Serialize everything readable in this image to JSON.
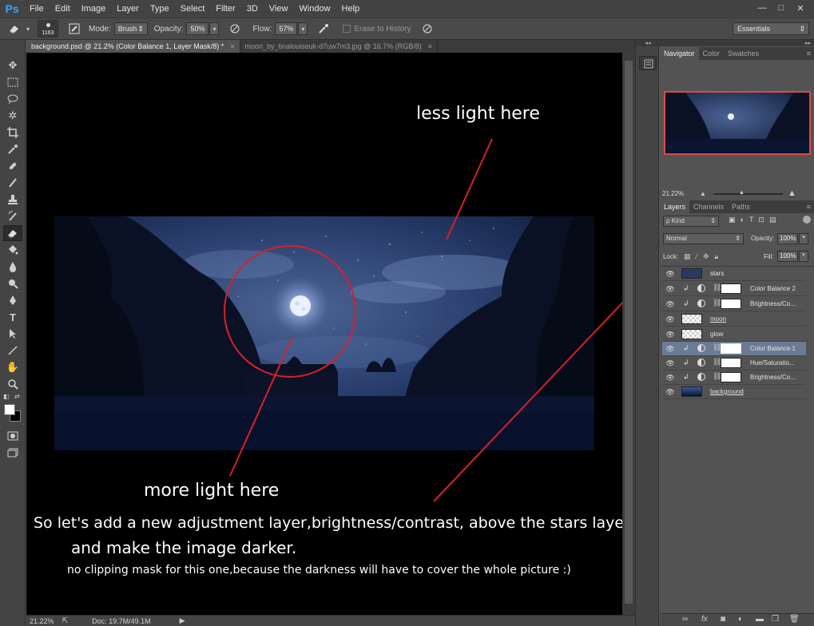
{
  "app": {
    "logo": "Ps"
  },
  "menu": [
    "File",
    "Edit",
    "Image",
    "Layer",
    "Type",
    "Select",
    "Filter",
    "3D",
    "View",
    "Window",
    "Help"
  ],
  "window_controls": [
    "—",
    "□",
    "✕"
  ],
  "options": {
    "brush_size": "1163",
    "mode_label": "Mode:",
    "mode_value": "Brush",
    "opacity_label": "Opacity:",
    "opacity_value": "50%",
    "flow_label": "Flow:",
    "flow_value": "57%",
    "erase_history": "Erase to History",
    "workspace": "Essentials"
  },
  "tabs": [
    {
      "label": "background.psd @ 21.2% (Color Balance 1, Layer Mask/8) *",
      "close": "×"
    },
    {
      "label": "moon_by_tinalouiseuk-d7uw7m3.jpg @ 16.7% (RGB/8)",
      "close": "×"
    }
  ],
  "annotations": {
    "less_light": "less light here",
    "more_light": "more light here",
    "line1": "So let's add a new adjustment layer,brightness/contrast, above the stars layer",
    "line2": "and make the image darker.",
    "line3": "no clipping mask for this one,because the darkness will have to cover the whole picture :)"
  },
  "status": {
    "zoom": "21.22%",
    "doc": "Doc: 19.7M/49.1M"
  },
  "navigator": {
    "tabs": [
      "Navigator",
      "Color",
      "Swatches"
    ],
    "zoom": "21.22%"
  },
  "layers_panel": {
    "tabs": [
      "Layers",
      "Channels",
      "Paths"
    ],
    "kind": "ρ Kind",
    "blend_mode": "Normal",
    "opacity_label": "Opacity:",
    "opacity_value": "100%",
    "lock_label": "Lock:",
    "fill_label": "Fill:",
    "fill_value": "100%",
    "layers": [
      {
        "name": "stars",
        "type": "pixel"
      },
      {
        "name": "Color Balance 2",
        "type": "adjustment"
      },
      {
        "name": "Brightness/Co...",
        "type": "adjustment"
      },
      {
        "name": "moon",
        "type": "pixel"
      },
      {
        "name": "glow",
        "type": "pixel"
      },
      {
        "name": "Color Balance 1",
        "type": "adjustment",
        "selected": true
      },
      {
        "name": "Hue/Saturatio...",
        "type": "adjustment"
      },
      {
        "name": "Brightness/Co...",
        "type": "adjustment"
      },
      {
        "name": "background",
        "type": "pixel"
      }
    ]
  },
  "colors": {
    "accent_red": "#d8202a",
    "selection": "#6a7b96",
    "ps_blue": "#31a8ff"
  }
}
